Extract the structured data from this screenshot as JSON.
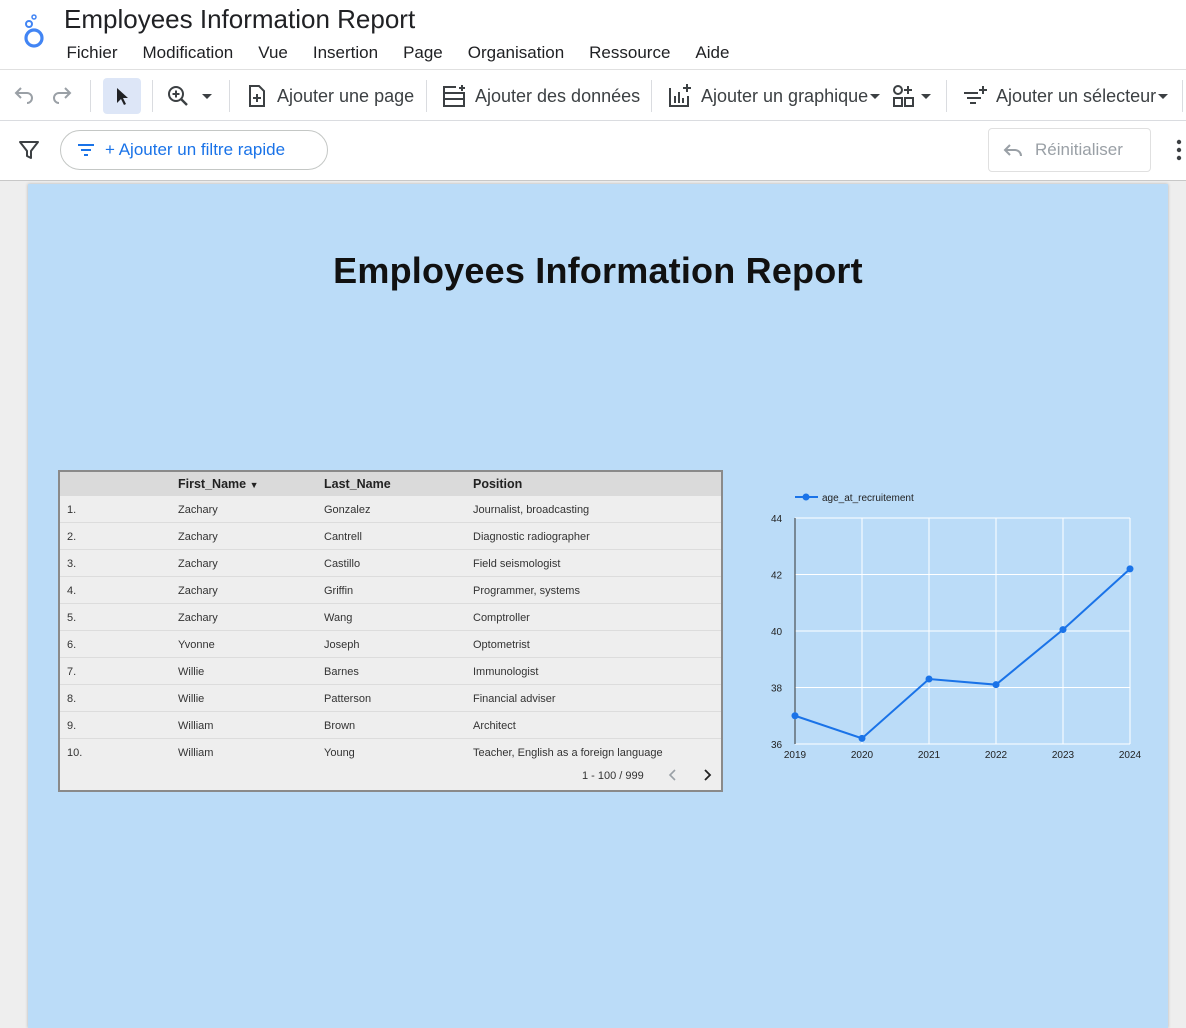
{
  "app": {
    "title": "Employees Information Report",
    "menu": [
      "Fichier",
      "Modification",
      "Vue",
      "Insertion",
      "Page",
      "Organisation",
      "Ressource",
      "Aide"
    ]
  },
  "toolbar": {
    "add_page": "Ajouter une page",
    "add_data": "Ajouter des données",
    "add_chart": "Ajouter un graphique",
    "add_selector": "Ajouter un sélecteur"
  },
  "filterbar": {
    "quick_filter": "+ Ajouter un filtre rapide",
    "reset": "Réinitialiser"
  },
  "report": {
    "title": "Employees Information Report"
  },
  "table": {
    "columns": [
      "First_Name",
      "Last_Name",
      "Position"
    ],
    "rows": [
      {
        "n": "1.",
        "first": "Zachary",
        "last": "Gonzalez",
        "position": "Journalist, broadcasting"
      },
      {
        "n": "2.",
        "first": "Zachary",
        "last": "Cantrell",
        "position": "Diagnostic radiographer"
      },
      {
        "n": "3.",
        "first": "Zachary",
        "last": "Castillo",
        "position": "Field seismologist"
      },
      {
        "n": "4.",
        "first": "Zachary",
        "last": "Griffin",
        "position": "Programmer, systems"
      },
      {
        "n": "5.",
        "first": "Zachary",
        "last": "Wang",
        "position": "Comptroller"
      },
      {
        "n": "6.",
        "first": "Yvonne",
        "last": "Joseph",
        "position": "Optometrist"
      },
      {
        "n": "7.",
        "first": "Willie",
        "last": "Barnes",
        "position": "Immunologist"
      },
      {
        "n": "8.",
        "first": "Willie",
        "last": "Patterson",
        "position": "Financial adviser"
      },
      {
        "n": "9.",
        "first": "William",
        "last": "Brown",
        "position": "Architect"
      },
      {
        "n": "10.",
        "first": "William",
        "last": "Young",
        "position": "Teacher, English as a foreign language"
      }
    ],
    "pagination": "1 - 100 / 999"
  },
  "chart_data": {
    "type": "line",
    "x": [
      "2019",
      "2020",
      "2021",
      "2022",
      "2023",
      "2024"
    ],
    "series": [
      {
        "name": "age_at_recruitement",
        "values": [
          37.0,
          36.2,
          38.3,
          38.1,
          40.05,
          42.2
        ]
      }
    ],
    "ylim": [
      36,
      44
    ],
    "yticks": [
      36,
      38,
      40,
      42,
      44
    ],
    "grid": true,
    "legend": "top-left",
    "color": "#1a73e8"
  }
}
